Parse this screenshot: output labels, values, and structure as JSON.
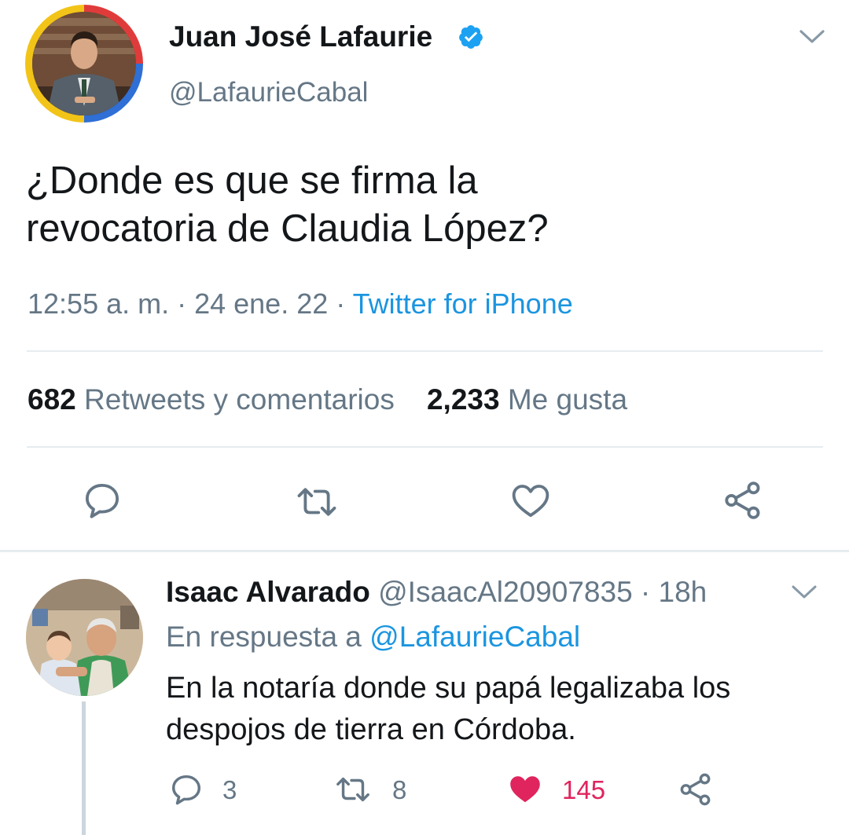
{
  "tweet": {
    "author_name": "Juan José Lafaurie",
    "author_handle": "@LafaurieCabal",
    "text_line1": "¿Donde es que se firma la",
    "text_line2": "revocatoria de Claudia López?",
    "timestamp": "12:55 a. m. · 24 ene. 22 · ",
    "source": "Twitter for iPhone",
    "retweets_count": "682",
    "retweets_label": "Retweets y comentarios",
    "likes_count": "2,233",
    "likes_label": "Me gusta"
  },
  "reply": {
    "author_name": "Isaac Alvarado",
    "author_handle": "@IsaacAl20907835",
    "time": " · 18h",
    "in_reply_prefix": "En respuesta a ",
    "in_reply_handle": "@LafaurieCabal",
    "text_line1": "En la notaría donde su papá legalizaba los",
    "text_line2": "despojos de tierra en Córdoba.",
    "reply_count": "3",
    "retweet_count": "8",
    "like_count": "145"
  },
  "colors": {
    "link": "#1b95e0",
    "secondary_text": "#657786",
    "like": "#e0245e",
    "divider": "#e6ecf0"
  },
  "icons": [
    "verified-badge-icon",
    "chevron-down-icon",
    "reply-icon",
    "retweet-icon",
    "like-icon",
    "share-icon"
  ]
}
